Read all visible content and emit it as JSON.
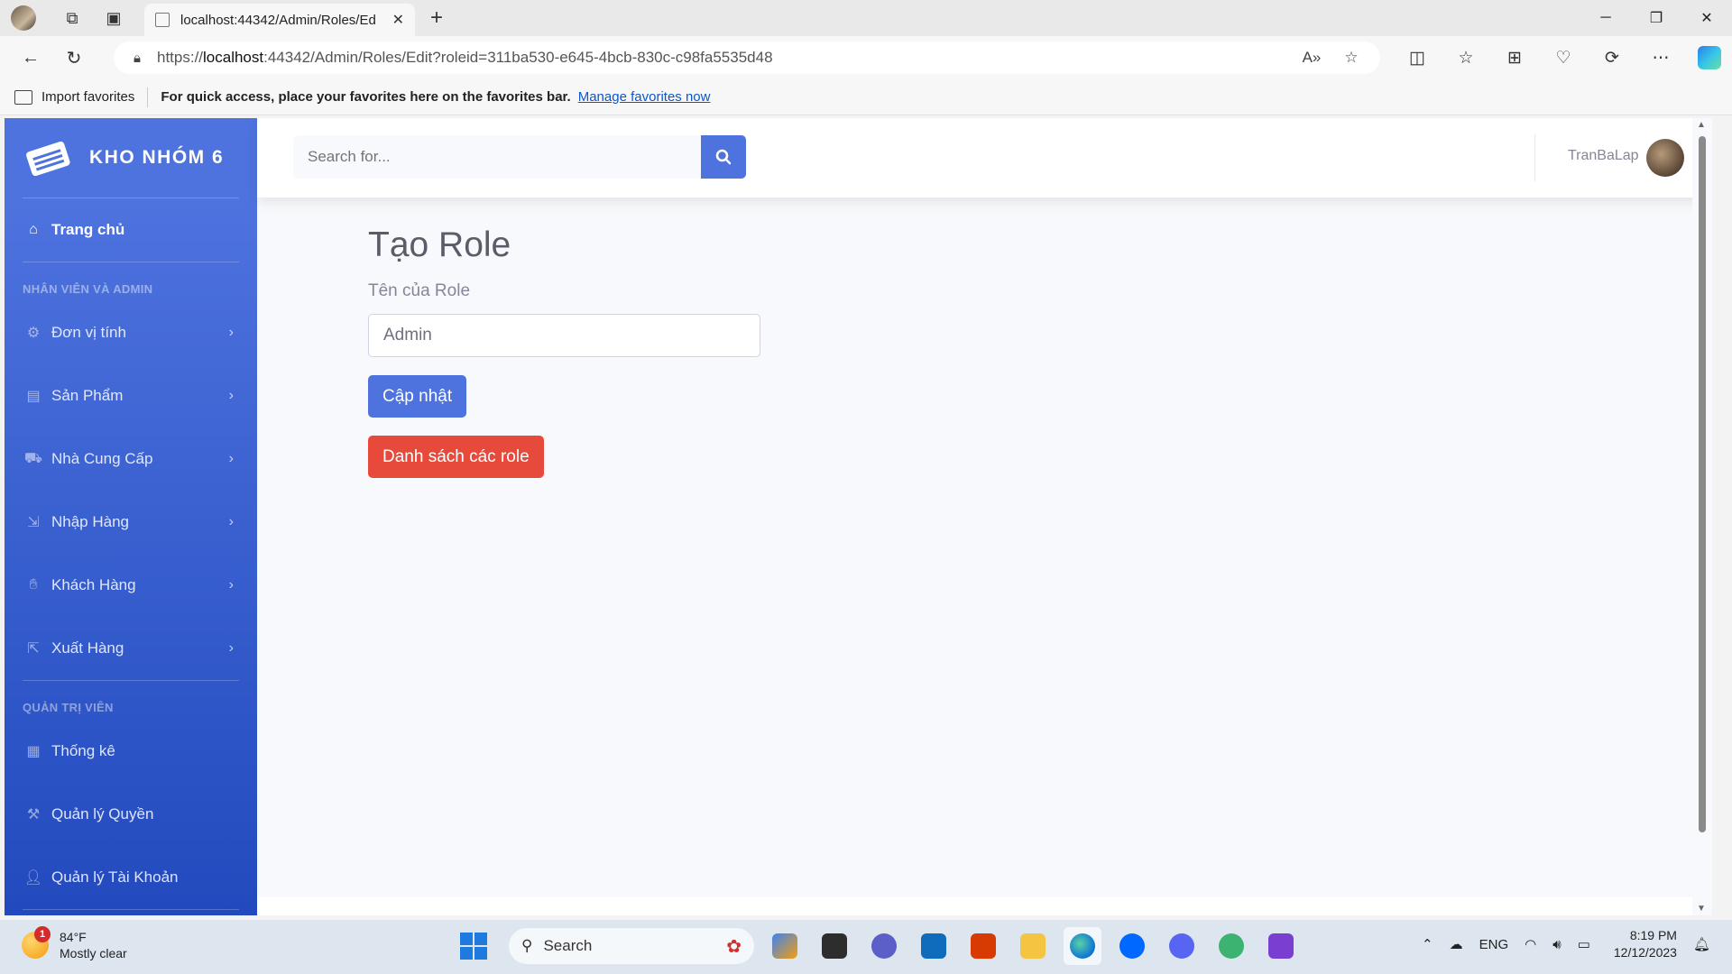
{
  "browser": {
    "tab_title": "localhost:44342/Admin/Roles/Ed",
    "url_prefix": "https://",
    "url_host": "localhost",
    "url_rest": ":44342/Admin/Roles/Edit?roleid=311ba530-e645-4bcb-830c-c98fa5535d48",
    "favbar": {
      "import_label": "Import favorites",
      "quick_text": "For quick access, place your favorites here on the favorites bar.",
      "manage_link": "Manage favorites now"
    }
  },
  "sidebar": {
    "brand": "KHO NHÓM 6",
    "home": "Trang chủ",
    "heading_staff": "NHÂN VIÊN VÀ ADMIN",
    "staff_items": [
      {
        "label": "Đơn vị tính",
        "icon": "gear-icon"
      },
      {
        "label": "Sản Phẩm",
        "icon": "pallet-icon"
      },
      {
        "label": "Nhà Cung Cấp",
        "icon": "truck-icon"
      },
      {
        "label": "Nhập Hàng",
        "icon": "file-import-icon"
      },
      {
        "label": "Khách Hàng",
        "icon": "handshake-icon"
      },
      {
        "label": "Xuất Hàng",
        "icon": "file-export-icon"
      }
    ],
    "heading_admin": "QUẢN TRỊ VIÊN",
    "admin_items": [
      {
        "label": "Thống kê",
        "icon": "calculator-icon"
      },
      {
        "label": "Quản lý Quyền",
        "icon": "gavel-icon"
      },
      {
        "label": "Quản lý Tài Khoản",
        "icon": "user-icon"
      }
    ]
  },
  "topbar": {
    "search_placeholder": "Search for...",
    "username": "TranBaLap"
  },
  "main": {
    "title": "Tạo Role",
    "field_label": "Tên của Role",
    "role_value": "Admin",
    "update_button": "Cập nhật",
    "list_button": "Danh sách các role"
  },
  "taskbar": {
    "weather_badge": "1",
    "temperature": "84°F",
    "condition": "Mostly clear",
    "search_label": "Search",
    "language": "ENG",
    "time": "8:19 PM",
    "date": "12/12/2023"
  },
  "colors": {
    "primary": "#4e73df",
    "danger": "#e74a3b",
    "sidebar_bottom": "#224abe"
  }
}
